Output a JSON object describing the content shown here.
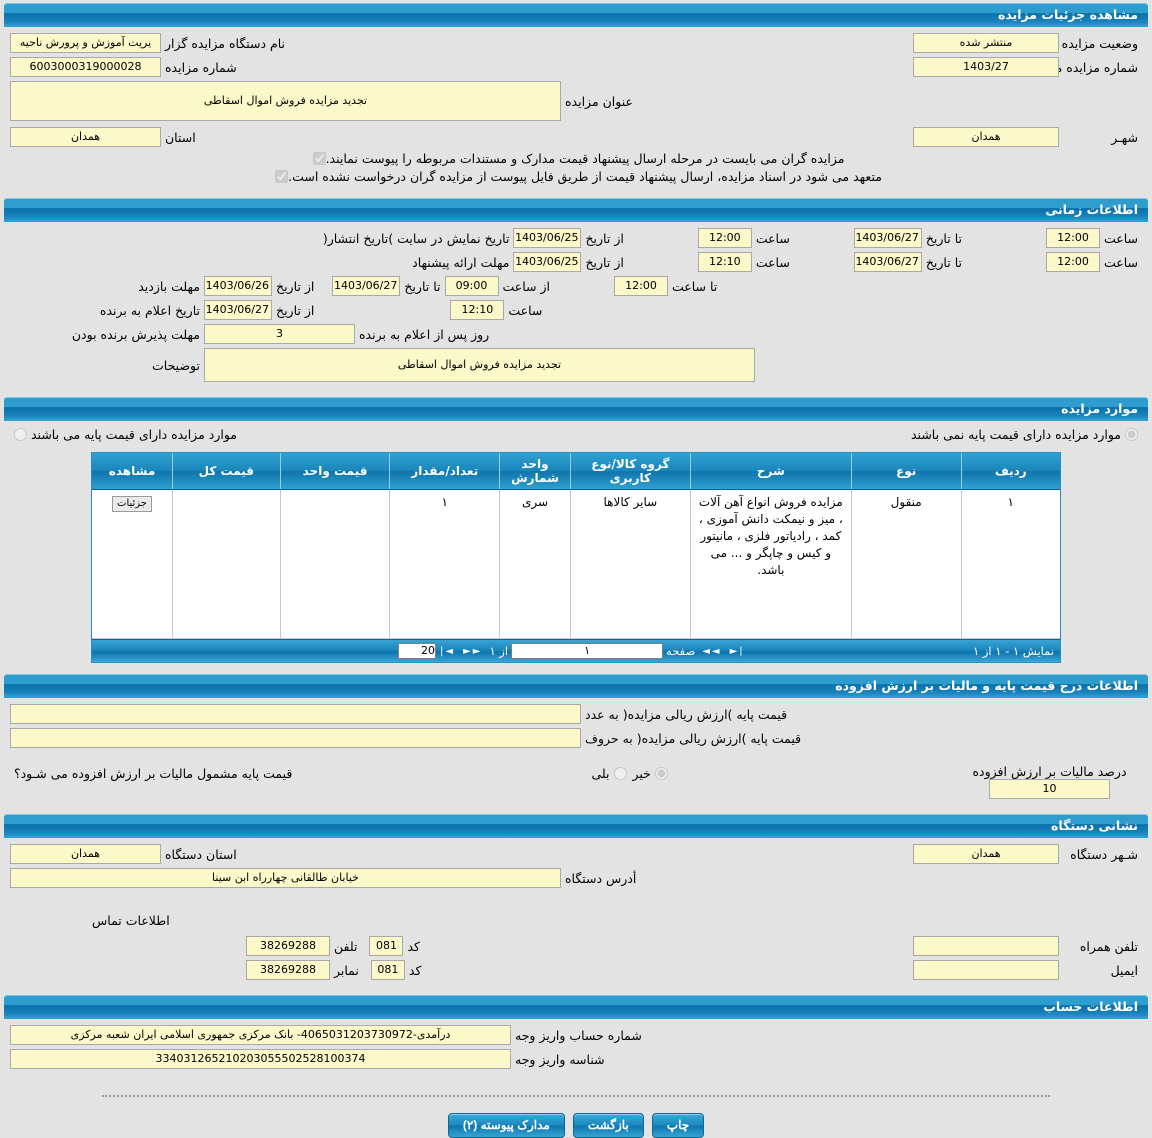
{
  "sections": {
    "details": {
      "title": "مشاهده جزئیات مزایده",
      "org_label": "نام دستگاه مزایده گزار",
      "org_value": "یریت آموزش و پرورش ناحیه",
      "status_label": "وضعیت مزایده",
      "status_value": "منتشر شده",
      "number_label": "شماره مزایده",
      "number_value": "6003000319000028",
      "ref_number_label": "شماره مزایده مرجع",
      "ref_number_value": "1403/27",
      "subject_label": "عنوان مزایده",
      "subject_value": "تجدید مزایده فروش اموال اسقاطی",
      "province_label": "استان",
      "province_value": "همدان",
      "city_label": "شهـر",
      "city_value": "همدان",
      "check1": "مزایده گران می بایست در مرحله ارسال پیشنهاد قیمت مدارک و مستندات مربوطه را پیوست نمایند.",
      "check2": "متعهد می شود در اسناد مزایده، ارسال پیشنهاد قیمت از طریق فایل پیوست از مزایده گران درخواست نشده است."
    },
    "timing": {
      "title": "اطلاعات زمانی",
      "rows": [
        {
          "label": "تاریخ نمایش در سایت )تاریخ انتشار(",
          "from_label": "از تاریخ",
          "from_date": "1403/06/25",
          "hour_label1": "ساعت",
          "hour1": "12:00",
          "to_label": "تا تاریخ",
          "to_date": "1403/06/27",
          "hour_label2": "ساعت",
          "hour2": "12:00"
        },
        {
          "label": "مهلت ارائه پیشنهاد",
          "from_label": "از تاریخ",
          "from_date": "1403/06/25",
          "hour_label1": "ساعت",
          "hour1": "12:10",
          "to_label": "تا تاریخ",
          "to_date": "1403/06/27",
          "hour_label2": "ساعت",
          "hour2": "12:00"
        }
      ],
      "visit": {
        "label": "مهلت بازدید",
        "from_label": "از تاریخ",
        "from_date": "1403/06/26",
        "to_label": "تا تاریخ",
        "to_date": "1403/06/27",
        "from_hour_label": "از ساعت",
        "from_hour": "09:00",
        "to_hour_label": "تا ساعت",
        "to_hour": "12:00"
      },
      "winner": {
        "label": "تاریخ اعلام به برنده",
        "from_label": "از تاریخ",
        "from_date": "1403/06/27",
        "hour_label": "ساعت",
        "hour": "12:10"
      },
      "accept": {
        "label": "مهلت پذیرش برنده بودن",
        "days": "3",
        "suffix": "روز پس از اعلام به برنده"
      },
      "notes_label": "توضیحات",
      "notes_value": "تجدید مزایده فروش اموال اسقاطی"
    },
    "items": {
      "title": "موارد مزایده",
      "radio_with_base": "موارد مزایده دارای قیمت پایه می باشند",
      "radio_without_base": "موارد مزایده دارای قیمت پایه نمی باشند",
      "selected": "without_base",
      "columns": [
        "ردیف",
        "نوع",
        "شرح",
        "گروه کالا/نوع کاربری",
        "واحد شمارش",
        "تعداد/مقدار",
        "قیمت واحد",
        "قیمت کل",
        "مشاهده"
      ],
      "rows": [
        {
          "radif": "۱",
          "noe": "منقول",
          "sharh": "مزایده فروش انواع آهن آلات ، میز و نیمکت دانش آموزی ، کمد ، رادیاتور فلزی ، مانیتور و کیس و چاپگر و ... می باشد.",
          "group": "سایر کالاها",
          "unit": "سری",
          "count": "۱",
          "unit_price": "",
          "total_price": "",
          "view_btn": "جزئیات"
        }
      ],
      "pager": {
        "showing": "نمایش ۱ - ۱ از ۱",
        "first_icon": "◄|",
        "prev_icon": "►►",
        "page_label": "صفحه",
        "page_value": "۱",
        "of_label": "از ۱",
        "next_icon": "◄◄",
        "last_icon": "|►",
        "page_size": "20"
      }
    },
    "price": {
      "title": "اطلاعات درج قیمت پایه و مالیات بر ارزش افزوده",
      "base_num_label": "قیمت پایه )ارزش ریالی مزایده( به عدد",
      "base_num_value": "",
      "base_txt_label": "قیمت پایه )ارزش ریالی مزایده( به حروف",
      "base_txt_value": "",
      "vat_question": "قیمت پایه مشمول مالیات بر ارزش افزوده می شـود؟",
      "vat_yes": "بلی",
      "vat_no": "خیر",
      "vat_selected": "no",
      "vat_percent_label": "درصد مالیات بر ارزش افزوده",
      "vat_percent_value": "10"
    },
    "address": {
      "title": "نشانی دستگاه",
      "province_label": "استان دستگاه",
      "province_value": "همدان",
      "city_label": "شـهر دستگاه",
      "city_value": "همدان",
      "addr_label": "أدرس دستگاه",
      "addr_value": "خیابان طالقانی چهارراه ابن سینا",
      "contact_title": "اطلاعات تماس",
      "phone_label": "تلفن",
      "phone_code_label": "کد",
      "phone_code": "081",
      "phone_value": "38269288",
      "mobile_label": "تلفن همراه",
      "mobile_value": "",
      "fax_label": "نمابر",
      "fax_code_label": "کد",
      "fax_code": "081",
      "fax_value": "38269288",
      "email_label": "ایمیل",
      "email_value": ""
    },
    "account": {
      "title": "اطلاعات حساب",
      "acc_label": "شماره حساب واریز وجه",
      "acc_value": "درآمدی-4065031203730972- بانک مرکزی جمهوری اسلامی ایران شعبه مرکزی",
      "id_label": "شناسه واریز وجه",
      "id_value": "334031265210203055502528100374"
    }
  },
  "footer": {
    "attachments": "مدارک پیوسته (۲)",
    "back": "بازگشت",
    "print": "چاپ"
  },
  "colors": {
    "header_blue": "#1a85bb",
    "field_yellow": "#fbf8c9",
    "page_bg": "#e3e3e3"
  }
}
